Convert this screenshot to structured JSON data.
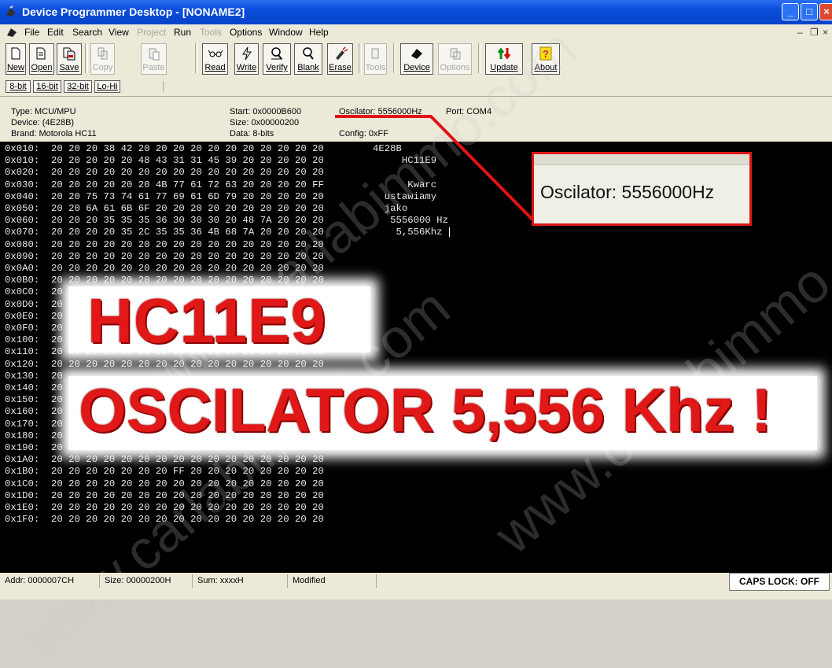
{
  "window": {
    "title": "Device Programmer Desktop - [NONAME2]"
  },
  "menu": [
    "File",
    "Edit",
    "Search",
    "View",
    "Project",
    "Run",
    "Tools",
    "Options",
    "Window",
    "Help"
  ],
  "toolbar": {
    "new": "New",
    "open": "Open",
    "save": "Save",
    "copy": "Copy",
    "paste": "Paste",
    "read": "Read",
    "write": "Write",
    "verify": "Verify",
    "blank": "Blank",
    "erase": "Erase",
    "tools": "Tools",
    "device": "Device",
    "options": "Options",
    "update": "Update",
    "about": "About"
  },
  "bitbar": [
    "8-bit",
    "16-bit",
    "32-bit",
    "Lo-Hi"
  ],
  "info": {
    "type": "Type: MCU/MPU",
    "device": "Device: (4E28B)",
    "brand": "Brand: Motorola HC11",
    "start": "Start: 0x0000B600",
    "size": "Size: 0x00000200",
    "data": "Data: 8-bits",
    "oscillator": "Oscilator: 5556000Hz",
    "port": "Port: COM4",
    "config": "Config: 0xFF"
  },
  "hex": {
    "rows": [
      "0x010:  20 20 20 38 42 20 20 20 20 20 20 20 20 20 20 20",
      "0x010:  20 20 20 20 20 48 43 31 31 45 39 20 20 20 20 20",
      "0x020:  20 20 20 20 20 20 20 20 20 20 20 20 20 20 20 20",
      "0x030:  20 20 20 20 20 20 4B 77 61 72 63 20 20 20 20 FF",
      "0x040:  20 20 75 73 74 61 77 69 61 6D 79 20 20 20 20 20",
      "0x050:  20 20 6A 61 6B 6F 20 20 20 20 20 20 20 20 20 20",
      "0x060:  20 20 20 35 35 35 36 30 30 30 20 48 7A 20 20 20",
      "0x070:  20 20 20 20 35 2C 35 35 36 4B 68 7A 20 20 20 20",
      "0x080:  20 20 20 20 20 20 20 20 20 20 20 20 20 20 20 20",
      "0x090:  20 20 20 20 20 20 20 20 20 20 20 20 20 20 20 20",
      "0x0A0:  20 20 20 20 20 20 20 20 20 20 20 20 20 20 20 20",
      "0x0B0:  20 20 20 20 20 20 20 20 20 20 20 20 20 20 20 20",
      "0x0C0:  20",
      "0x0D0:  20",
      "0x0E0:  20",
      "0x0F0:  20",
      "0x100:  20",
      "0x110:  20 20 20 20 20 20 20 20 20 20 20 20 20 20 20 20",
      "0x120:  20 20 20 20 20 20 20 20 20 20 20 20 20 20 20 20",
      "0x130:  20",
      "0x140:  20",
      "0x150:  20",
      "0x160:  20",
      "0x170:  20",
      "0x180:  20",
      "0x190:  20 20 20 20 20 20 20 20 20 20 20 20 20 20 20 20",
      "0x1A0:  20 20 20 20 20 20 20 20 20 20 20 20 20 20 20 20",
      "0x1B0:  20 20 20 20 20 20 20 FF 20 20 20 20 20 20 20 20",
      "0x1C0:  20 20 20 20 20 20 20 20 20 20 20 20 20 20 20 20",
      "0x1D0:  20 20 20 20 20 20 20 20 20 20 20 20 20 20 20 20",
      "0x1E0:  20 20 20 20 20 20 20 20 20 20 20 20 20 20 20 20",
      "0x1F0:  20 20 20 20 20 20 20 20 20 20 20 20 20 20 20 20"
    ],
    "ascii": [
      "4E28B",
      "     HC11E9",
      "",
      "      Kwarc",
      "  ustawiamy",
      "  jako",
      "   5556000 Hz",
      "    5,556Khz"
    ]
  },
  "callout": "Oscilator: 5556000Hz",
  "overlay": {
    "line1": "HC11E9",
    "line2": "OSCILATOR 5,556 Khz !"
  },
  "watermark": "www.carlabimmo.com",
  "status": {
    "addr": "Addr: 0000007CH",
    "size": "Size: 00000200H",
    "sum": "Sum: xxxxH",
    "state": "Modified",
    "caps": "CAPS LOCK: OFF"
  },
  "colors": {
    "titlebar": "#0a4ddc",
    "accent_red": "#e01818",
    "hex_bg": "#000000"
  }
}
